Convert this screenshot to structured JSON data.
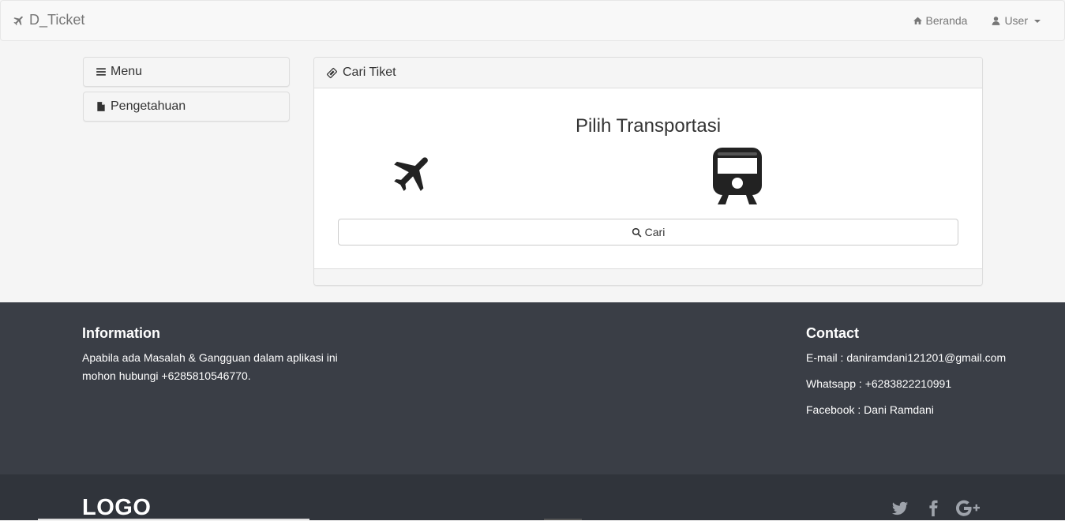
{
  "navbar": {
    "brand": "D_Ticket",
    "home_label": "Beranda",
    "user_label": "User"
  },
  "sidebar": {
    "menu_label": "Menu",
    "knowledge_label": "Pengetahuan"
  },
  "main": {
    "heading": "Cari Tiket",
    "title": "Pilih Transportasi",
    "options": [
      "plane-icon",
      "train-icon"
    ],
    "search_label": "Cari"
  },
  "footer": {
    "info_title": "Information",
    "info_line1": "Apabila ada Masalah & Gangguan dalam aplikasi ini",
    "info_line2": "mohon hubungi +6285810546770.",
    "contact_title": "Contact",
    "email": "E-mail : daniramdani121201@gmail.com",
    "whatsapp": "Whatsapp : +6283822210991",
    "facebook": "Facebook : Dani Ramdani",
    "logo": "LOGO",
    "social": [
      "twitter-icon",
      "facebook-icon",
      "google-plus-icon"
    ]
  },
  "colors": {
    "footer_bg": "#3a3e46",
    "footer_bottom_bg": "#30343b",
    "navbar_bg": "#f8f8f8"
  }
}
